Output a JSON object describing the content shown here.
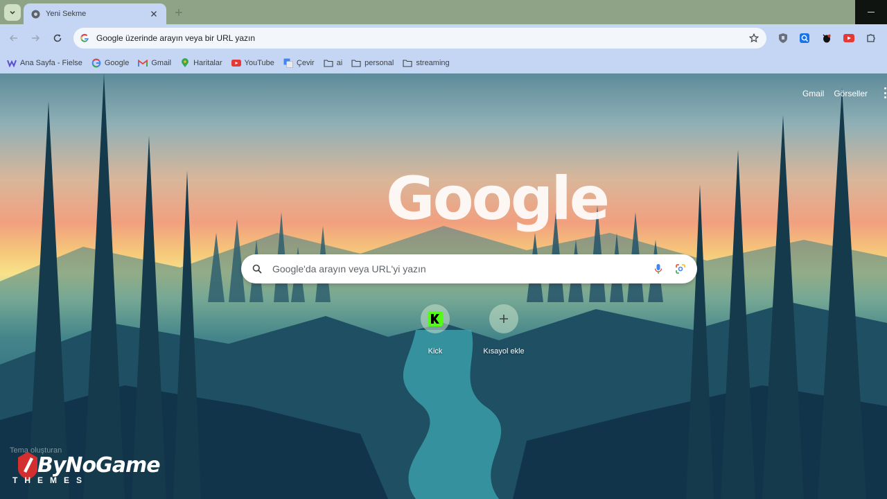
{
  "tab": {
    "title": "Yeni Sekme",
    "favicon": "chrome-icon"
  },
  "omnibox": {
    "text": "Google üzerinde arayın veya bir URL yazın"
  },
  "bookmarks": [
    {
      "label": "Ana Sayfa - Fielse",
      "icon": "fielse-icon"
    },
    {
      "label": "Google",
      "icon": "google-icon"
    },
    {
      "label": "Gmail",
      "icon": "gmail-icon"
    },
    {
      "label": "Haritalar",
      "icon": "maps-icon"
    },
    {
      "label": "YouTube",
      "icon": "youtube-icon"
    },
    {
      "label": "Çevir",
      "icon": "translate-icon"
    },
    {
      "label": "ai",
      "icon": "folder-icon"
    },
    {
      "label": "personal",
      "icon": "folder-icon"
    },
    {
      "label": "streaming",
      "icon": "folder-icon"
    }
  ],
  "toplinks": {
    "gmail": "Gmail",
    "images": "Görseller"
  },
  "logo": "Google",
  "search": {
    "placeholder": "Google'da arayın veya URL'yi yazın"
  },
  "shortcuts": [
    {
      "label": "Kick",
      "icon": "kick-icon"
    },
    {
      "label": "Kısayol ekle",
      "icon": "plus-icon"
    }
  ],
  "theme": {
    "credit": "Tema oluşturan",
    "brand": "ByNoGame",
    "brand_sub": "THEMES"
  },
  "colors": {
    "frame": "#8fa487",
    "toolbar": "#c5d6f5",
    "omnibox": "#f3f6fb"
  }
}
